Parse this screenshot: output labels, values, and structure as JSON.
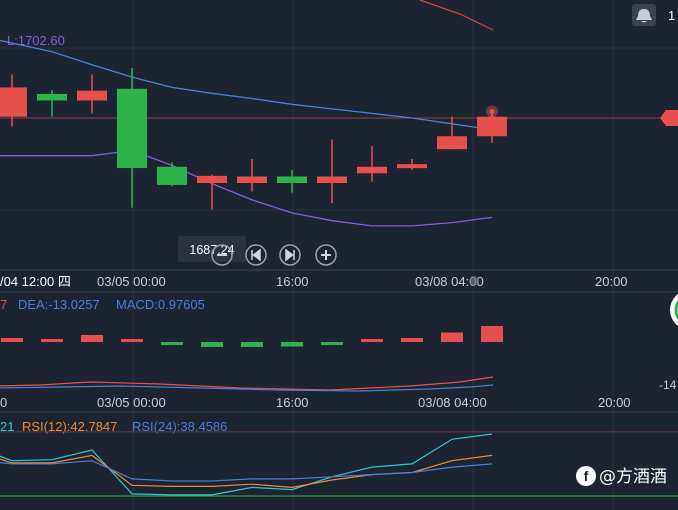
{
  "colors": {
    "background": "#1c2331",
    "grid": "#2a3344",
    "up": "#e8504d",
    "down": "#2db34a",
    "ma_blue": "#4a7fd8",
    "ma_purple": "#8a5ad8",
    "ma_red": "#d84a3a",
    "macd_dif": "#e8504d",
    "dea": "#4a7fd8",
    "macd_label": "#4a7fd8",
    "rsi6": "#2ec6d4",
    "rsi12": "#f08a30",
    "rsi24": "#4a7fd8",
    "rsi_level": "#2db34a",
    "text": "#c8ccd6",
    "current_price_bg": "#e8504d"
  },
  "header": {
    "low_label": "L:1702.60",
    "right_badge": "1"
  },
  "chart_data": [
    {
      "type": "candlestick",
      "candles": [
        {
          "open": 1701.5,
          "close": 1706.0,
          "high": 1708.0,
          "low": 1700.0,
          "direction": "up"
        },
        {
          "open": 1705.0,
          "close": 1704.0,
          "high": 1705.6,
          "low": 1701.5,
          "direction": "down"
        },
        {
          "open": 1704.0,
          "close": 1705.5,
          "high": 1708.0,
          "low": 1702.0,
          "direction": "up"
        },
        {
          "open": 1705.8,
          "close": 1693.6,
          "high": 1709.0,
          "low": 1687.5,
          "direction": "down"
        },
        {
          "open": 1693.8,
          "close": 1691.0,
          "high": 1694.5,
          "low": 1690.8,
          "direction": "down"
        },
        {
          "open": 1691.3,
          "close": 1692.4,
          "high": 1692.6,
          "low": 1687.2,
          "direction": "up"
        },
        {
          "open": 1691.3,
          "close": 1692.3,
          "high": 1695.0,
          "low": 1690.0,
          "direction": "up"
        },
        {
          "open": 1692.3,
          "close": 1691.3,
          "high": 1693.3,
          "low": 1689.8,
          "direction": "down"
        },
        {
          "open": 1691.3,
          "close": 1692.3,
          "high": 1698.0,
          "low": 1688.2,
          "direction": "up"
        },
        {
          "open": 1692.8,
          "close": 1693.8,
          "high": 1697.0,
          "low": 1691.5,
          "direction": "up"
        },
        {
          "open": 1693.6,
          "close": 1694.2,
          "high": 1695.0,
          "low": 1693.3,
          "direction": "up"
        },
        {
          "open": 1696.5,
          "close": 1698.5,
          "high": 1701.5,
          "low": 1696.5,
          "direction": "up"
        },
        {
          "open": 1698.5,
          "close": 1701.5,
          "high": 1702.6,
          "low": 1697.5,
          "direction": "up"
        }
      ],
      "moving_averages": [
        {
          "color": "#4a7fd8",
          "values": [
            1713.5,
            1711.5,
            1709.5,
            1707.6,
            1706.0,
            1705.1,
            1704.3,
            1703.4,
            1702.7,
            1702.0,
            1701.3,
            1700.4,
            1699.5
          ]
        },
        {
          "color": "#8a5ad8",
          "values": [
            1695.5,
            1695.5,
            1695.5,
            1696.3,
            1694.0,
            1691.2,
            1688.7,
            1686.7,
            1685.5,
            1684.7,
            1684.7,
            1685.2,
            1686.0
          ]
        }
      ],
      "current_price_line": 1701.3,
      "crosshair_price_label": "1687.24",
      "x_tick_labels": [
        "/04 12:00 四",
        "03/05 00:00",
        "16:00",
        "03/08 04:00",
        "20:00"
      ]
    },
    {
      "type": "macd",
      "labels": {
        "dif_fragment": "7",
        "dea": "DEA:-13.0257",
        "macd": "MACD:0.97605"
      },
      "histogram": [
        -0.4,
        -0.3,
        -0.7,
        -0.15,
        0.3,
        0.5,
        0.5,
        0.45,
        0.18,
        -0.15,
        -0.4,
        -0.95,
        -1.6
      ],
      "right_axis_label": "-14",
      "x_tick_labels": [
        "0",
        "03/05 00:00",
        "16:00",
        "03/08 04:00",
        "20:00"
      ]
    },
    {
      "type": "rsi",
      "labels": {
        "rsi6_fragment": "21",
        "rsi12": "RSI(12):42.7847",
        "rsi24": "RSI(24):38.4586"
      },
      "series": [
        {
          "color": "#2ec6d4",
          "values": [
            60,
            53,
            54,
            63,
            22,
            21,
            21,
            28,
            26,
            38,
            47,
            50,
            73,
            78
          ]
        },
        {
          "color": "#f08a30",
          "values": [
            57,
            51,
            51,
            58,
            30,
            29,
            29,
            31,
            28,
            35,
            40,
            42,
            53,
            58
          ]
        },
        {
          "color": "#4a7fd8",
          "values": [
            52,
            50,
            50,
            53,
            36,
            34,
            34,
            36,
            36,
            38,
            40,
            42,
            47,
            50
          ]
        }
      ],
      "levels": [
        20,
        80
      ]
    }
  ],
  "controls": {
    "buttons": [
      "minus-icon",
      "prev-icon",
      "next-icon",
      "plus-icon"
    ]
  },
  "watermark": {
    "text": "@方酒酒",
    "brand_glyph": "f"
  }
}
